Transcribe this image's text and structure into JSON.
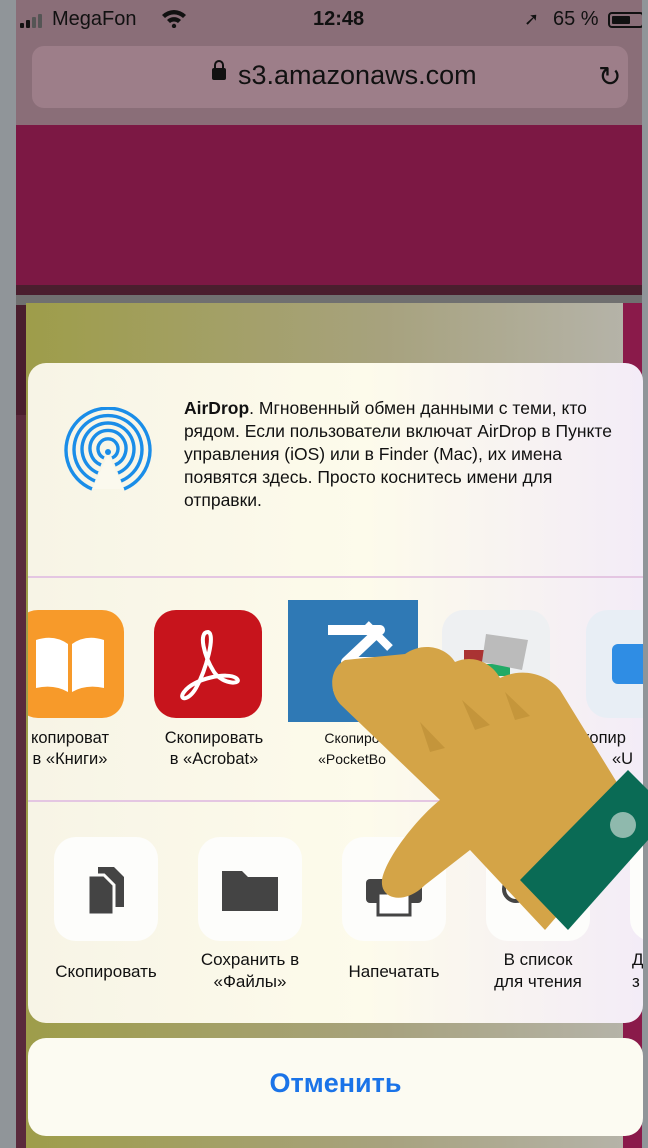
{
  "statusbar": {
    "carrier": "MegaFon",
    "time": "12:48",
    "battery": "65 %"
  },
  "browser": {
    "url": "s3.amazonaws.com",
    "reload_icon": "reload-icon"
  },
  "share_sheet": {
    "airdrop": {
      "title": "AirDrop",
      "text": ". Мгновенный обмен данными с теми, кто рядом. Если пользователи включат AirDrop в Пункте управления (iOS) или в Finder (Mac), их имена появятся здесь. Просто коснитесь имени для отправки."
    },
    "apps": [
      {
        "line1": "копироват",
        "line2": "в «Книги»",
        "color": "#f79a2a"
      },
      {
        "line1": "Скопировать",
        "line2": "в «Acrobat»",
        "color": "#c7141c"
      },
      {
        "line1": "Скопиро",
        "line2": "«PocketBo",
        "color": "#2f79b5"
      },
      {
        "line1": "",
        "line2": "",
        "color": "#eef0f2"
      },
      {
        "line1": "копир",
        "line2": "«U",
        "color": "#e8eef5"
      }
    ],
    "actions": [
      {
        "line1": "Скопировать",
        "line2": ""
      },
      {
        "line1": "Сохранить в",
        "line2": "«Файлы»"
      },
      {
        "line1": "Напечатать",
        "line2": ""
      },
      {
        "line1": "В список",
        "line2": "для чтения"
      },
      {
        "line1": "Д",
        "line2": "з"
      }
    ]
  },
  "cancel_label": "Отменить",
  "colors": {
    "accent": "#1a73e8",
    "hand_skin": "#d4a447",
    "cuff": "#0a6b55"
  }
}
